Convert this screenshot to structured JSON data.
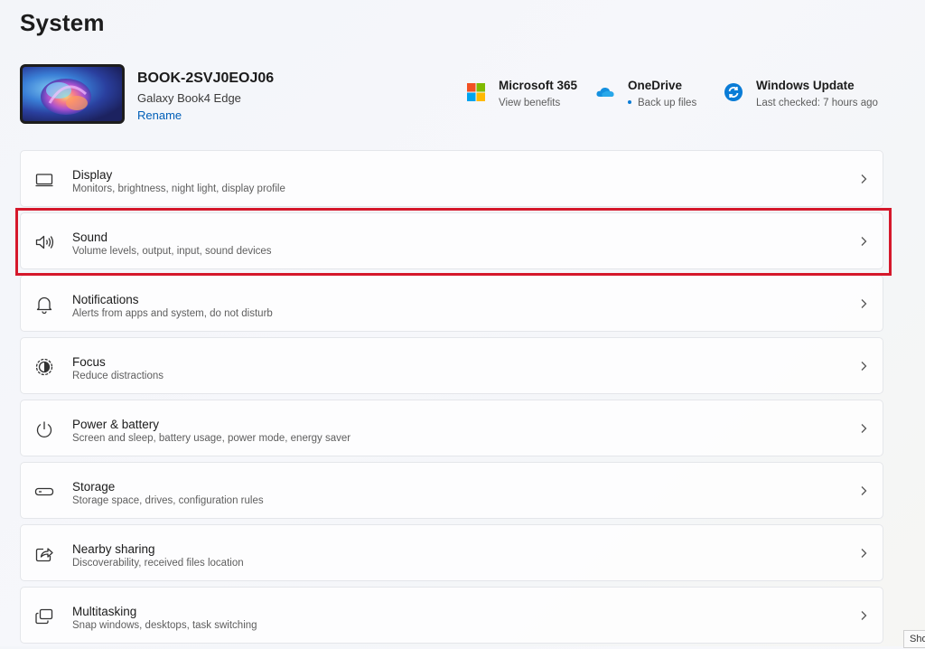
{
  "page": {
    "title": "System"
  },
  "device": {
    "name": "BOOK-2SVJ0EOJ06",
    "model": "Galaxy Book4 Edge",
    "rename_label": "Rename"
  },
  "quick_links": [
    {
      "title": "Microsoft 365",
      "subtitle": "View benefits",
      "icon": "microsoft-365-icon"
    },
    {
      "title": "OneDrive",
      "subtitle": "Back up files",
      "icon": "onedrive-icon"
    },
    {
      "title": "Windows Update",
      "subtitle": "Last checked: 7 hours ago",
      "icon": "windows-update-icon"
    }
  ],
  "settings": [
    {
      "title": "Display",
      "description": "Monitors, brightness, night light, display profile",
      "icon": "display-icon"
    },
    {
      "title": "Sound",
      "description": "Volume levels, output, input, sound devices",
      "icon": "speaker-icon",
      "highlighted": true
    },
    {
      "title": "Notifications",
      "description": "Alerts from apps and system, do not disturb",
      "icon": "bell-icon"
    },
    {
      "title": "Focus",
      "description": "Reduce distractions",
      "icon": "focus-icon"
    },
    {
      "title": "Power & battery",
      "description": "Screen and sleep, battery usage, power mode, energy saver",
      "icon": "power-icon"
    },
    {
      "title": "Storage",
      "description": "Storage space, drives, configuration rules",
      "icon": "storage-icon"
    },
    {
      "title": "Nearby sharing",
      "description": "Discoverability, received files location",
      "icon": "share-icon"
    },
    {
      "title": "Multitasking",
      "description": "Snap windows, desktops, task switching",
      "icon": "multitasking-icon"
    }
  ],
  "colors": {
    "accent": "#005fb8",
    "highlight": "#d5182b"
  },
  "corner_label": "Sho"
}
